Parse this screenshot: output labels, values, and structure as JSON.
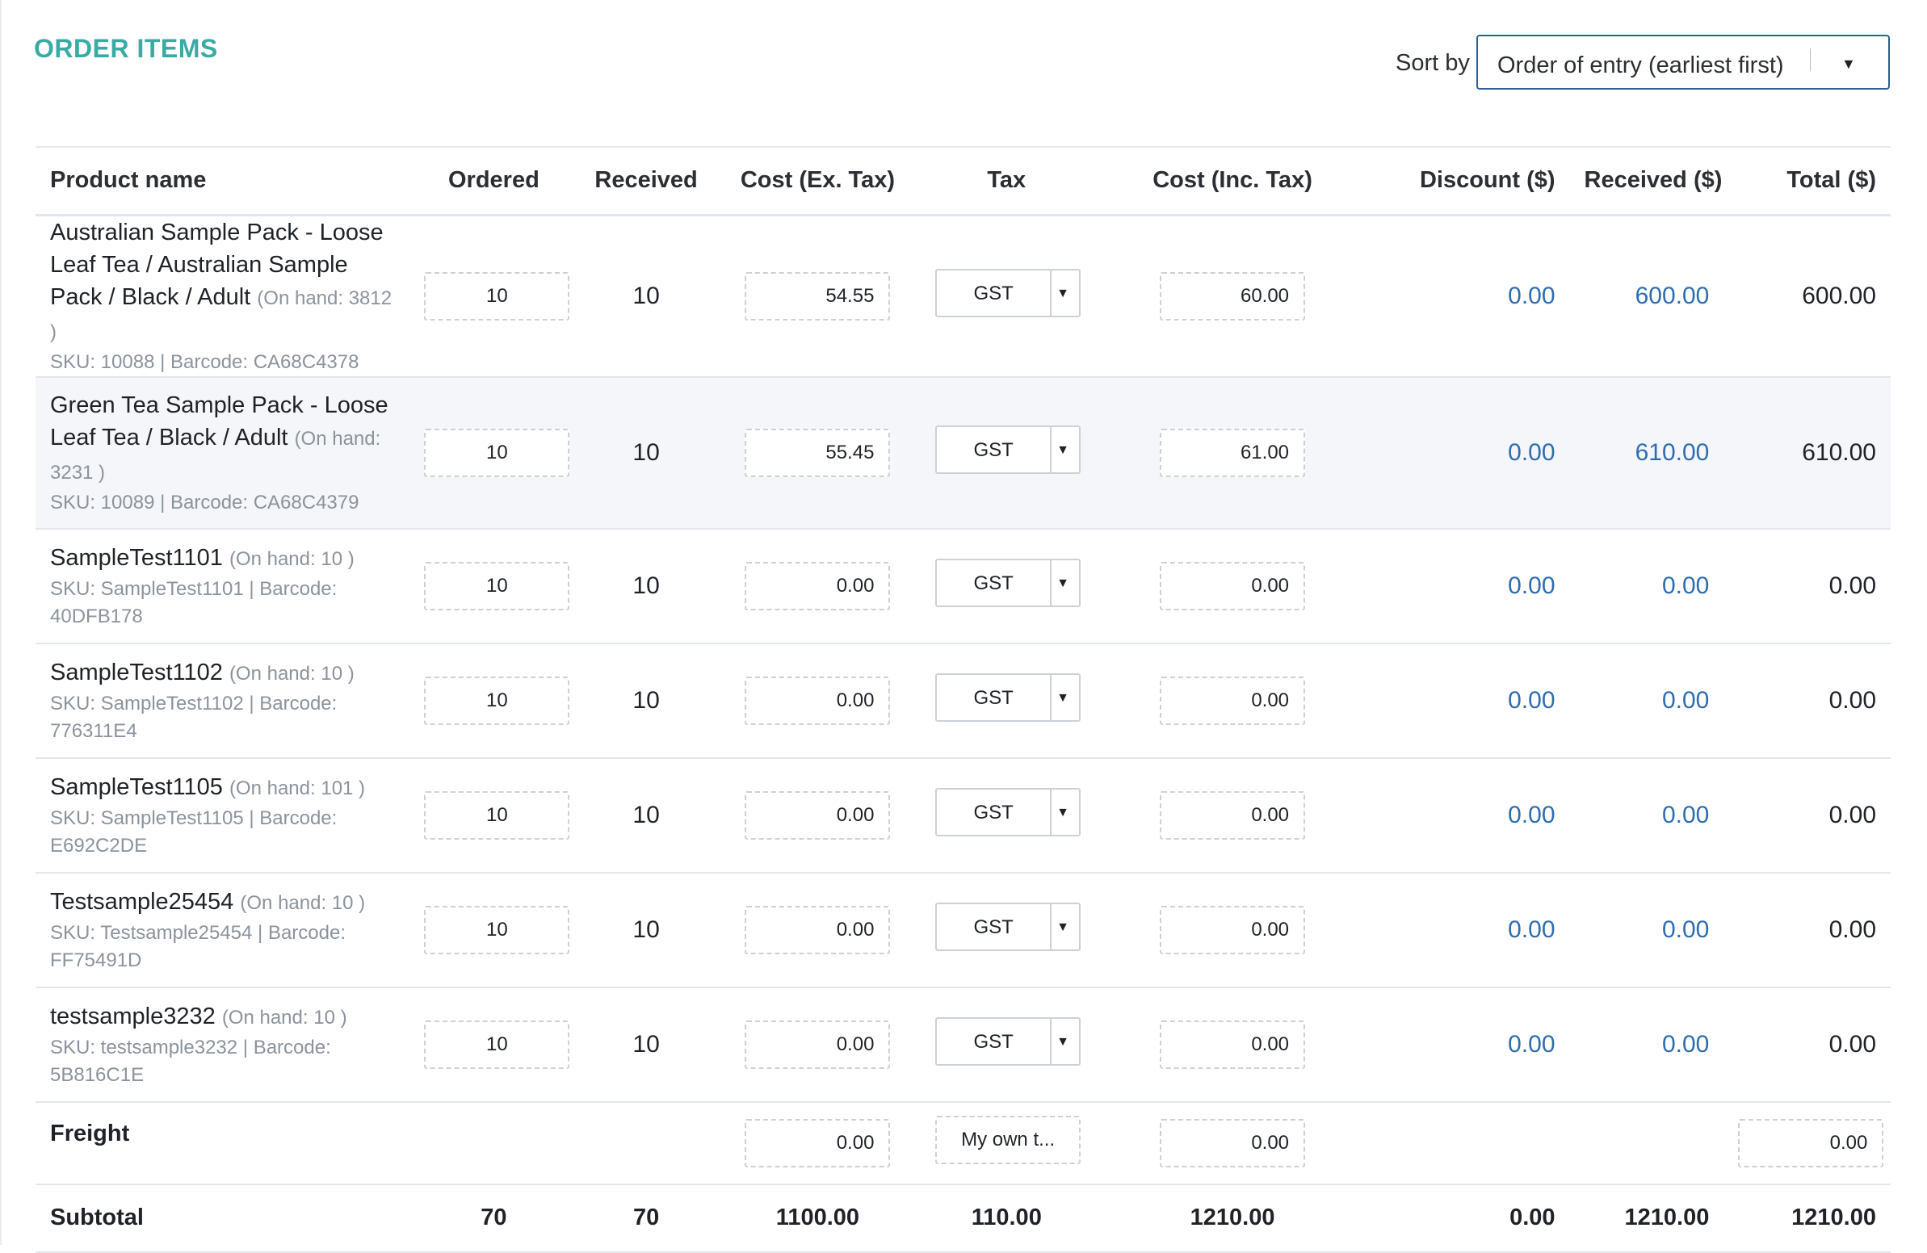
{
  "section_title": "ORDER ITEMS",
  "sort": {
    "label": "Sort by",
    "selected": "Order of entry (earliest first)"
  },
  "columns": [
    "Product name",
    "Ordered",
    "Received",
    "Cost (Ex. Tax)",
    "Tax",
    "Cost (Inc. Tax)",
    "Discount ($)",
    "Received ($)",
    "Total ($)"
  ],
  "items": [
    {
      "name": "Australian Sample Pack - Loose Leaf Tea / Australian Sample Pack / Black / Adult",
      "on_hand": "(On hand: 3812 )",
      "sku_line": "SKU: 10088 | Barcode: CA68C4378",
      "ordered": "10",
      "received": "10",
      "cost_ex": "54.55",
      "tax": "GST",
      "cost_inc": "60.00",
      "discount": "0.00",
      "received_amt": "600.00",
      "total": "600.00"
    },
    {
      "name": "Green Tea Sample Pack - Loose Leaf Tea / Black / Adult",
      "on_hand": "(On hand: 3231 )",
      "sku_line": "SKU: 10089 | Barcode: CA68C4379",
      "ordered": "10",
      "received": "10",
      "cost_ex": "55.45",
      "tax": "GST",
      "cost_inc": "61.00",
      "discount": "0.00",
      "received_amt": "610.00",
      "total": "610.00"
    },
    {
      "name": "SampleTest1101",
      "on_hand": "(On hand: 10 )",
      "sku_line": "SKU: SampleTest1101 | Barcode: 40DFB178",
      "ordered": "10",
      "received": "10",
      "cost_ex": "0.00",
      "tax": "GST",
      "cost_inc": "0.00",
      "discount": "0.00",
      "received_amt": "0.00",
      "total": "0.00"
    },
    {
      "name": "SampleTest1102",
      "on_hand": "(On hand: 10 )",
      "sku_line": "SKU: SampleTest1102 | Barcode: 776311E4",
      "ordered": "10",
      "received": "10",
      "cost_ex": "0.00",
      "tax": "GST",
      "cost_inc": "0.00",
      "discount": "0.00",
      "received_amt": "0.00",
      "total": "0.00"
    },
    {
      "name": "SampleTest1105",
      "on_hand": "(On hand: 101 )",
      "sku_line": "SKU: SampleTest1105 | Barcode: E692C2DE",
      "ordered": "10",
      "received": "10",
      "cost_ex": "0.00",
      "tax": "GST",
      "cost_inc": "0.00",
      "discount": "0.00",
      "received_amt": "0.00",
      "total": "0.00"
    },
    {
      "name": "Testsample25454",
      "on_hand": "(On hand: 10 )",
      "sku_line": "SKU: Testsample25454 | Barcode: FF75491D",
      "ordered": "10",
      "received": "10",
      "cost_ex": "0.00",
      "tax": "GST",
      "cost_inc": "0.00",
      "discount": "0.00",
      "received_amt": "0.00",
      "total": "0.00"
    },
    {
      "name": "testsample3232",
      "on_hand": "(On hand: 10 )",
      "sku_line": "SKU: testsample3232 | Barcode: 5B816C1E",
      "ordered": "10",
      "received": "10",
      "cost_ex": "0.00",
      "tax": "GST",
      "cost_inc": "0.00",
      "discount": "0.00",
      "received_amt": "0.00",
      "total": "0.00"
    }
  ],
  "freight": {
    "label": "Freight",
    "cost_ex": "0.00",
    "tax": "My own t...",
    "cost_inc": "0.00",
    "total": "0.00"
  },
  "subtotal": {
    "label": "Subtotal",
    "ordered": "70",
    "received": "70",
    "cost_ex": "1100.00",
    "tax": "110.00",
    "cost_inc": "1210.00",
    "discount": "0.00",
    "received_amt": "1210.00",
    "total": "1210.00"
  },
  "colors": {
    "title": "#3aaba4",
    "link": "#2f6db1",
    "select_border": "#2f5f97",
    "muted": "#8b939c"
  }
}
